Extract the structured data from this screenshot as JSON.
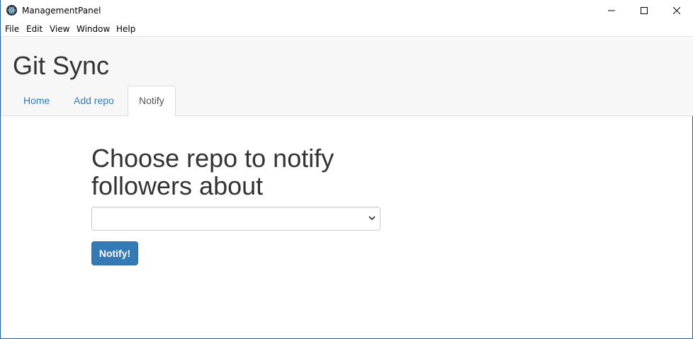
{
  "window": {
    "title": "ManagementPanel"
  },
  "menu": {
    "items": [
      "File",
      "Edit",
      "View",
      "Window",
      "Help"
    ]
  },
  "header": {
    "brand": "Git Sync",
    "tabs": [
      {
        "label": "Home",
        "active": false
      },
      {
        "label": "Add repo",
        "active": false
      },
      {
        "label": "Notify",
        "active": true
      }
    ]
  },
  "main": {
    "heading": "Choose repo to notify followers about",
    "select": {
      "value": ""
    },
    "button_label": "Notify!"
  },
  "colors": {
    "link": "#337ab7",
    "primary_button": "#337ab7",
    "header_bg": "#f7f7f7"
  },
  "icons": {
    "app": "electron-icon",
    "minimize": "minimize-icon",
    "maximize": "maximize-icon",
    "close": "close-icon",
    "select": "chevron-down-icon"
  }
}
